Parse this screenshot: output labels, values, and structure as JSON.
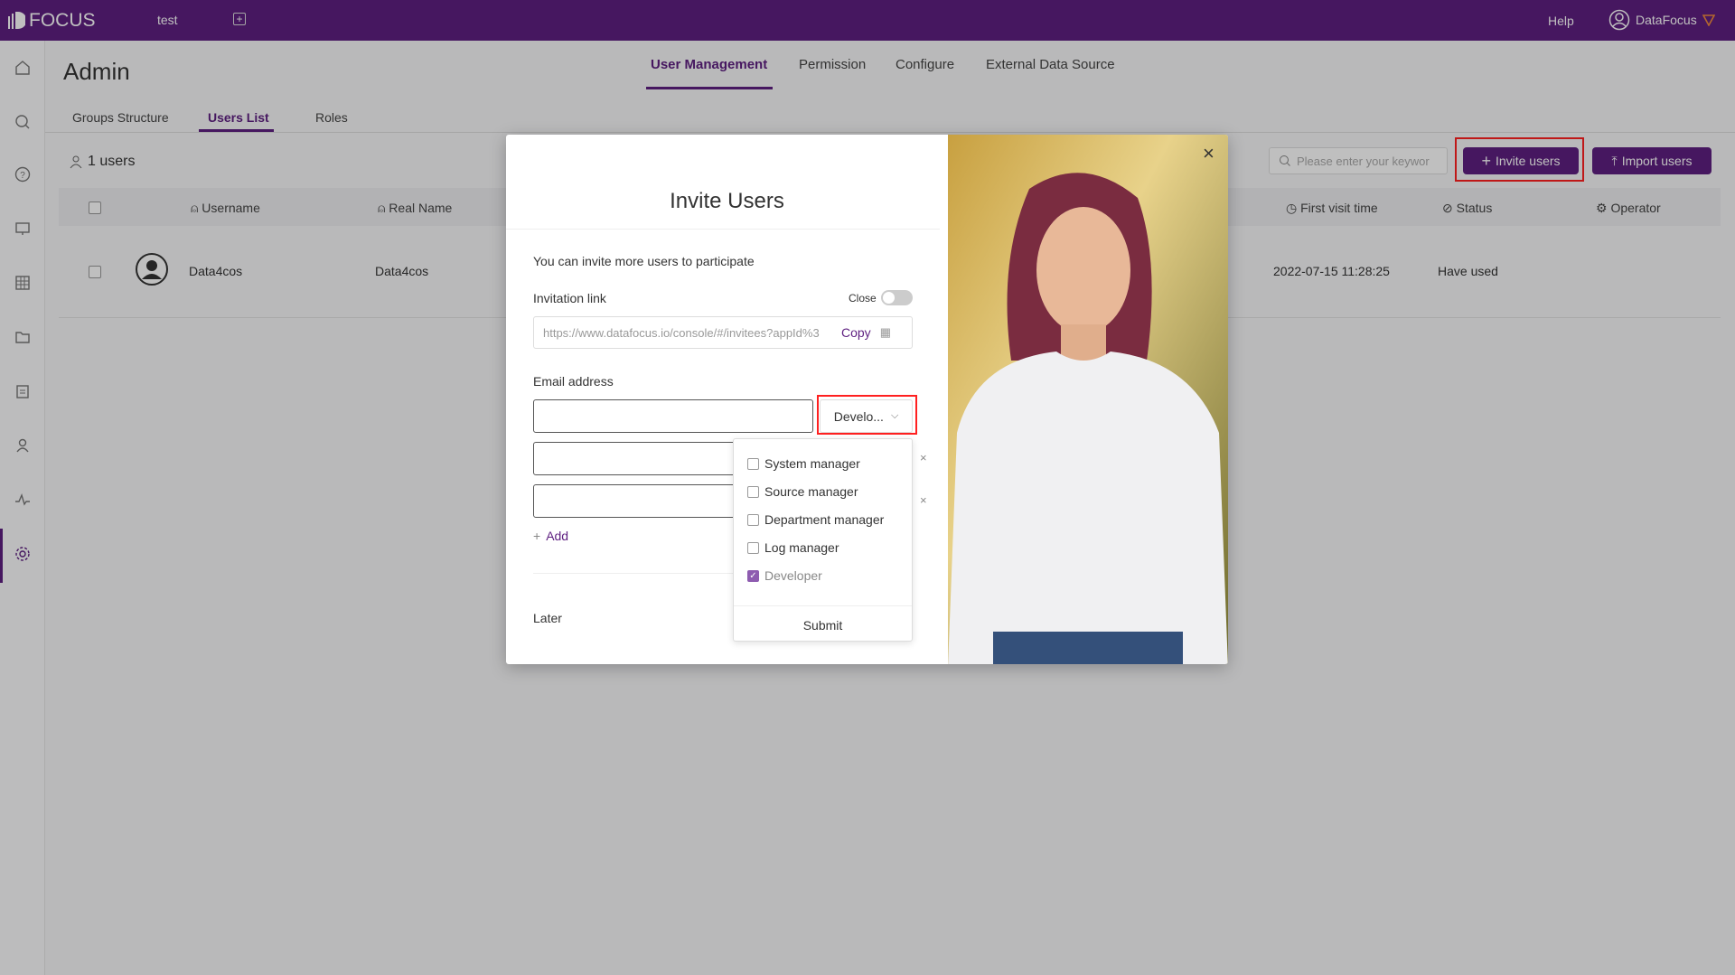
{
  "topbar": {
    "logo": "FOCUS",
    "workspace": "test",
    "help": "Help",
    "user": "DataFocus"
  },
  "sidebar": {
    "icons": [
      "home-icon",
      "search-icon",
      "help-icon",
      "presentation-icon",
      "table-icon",
      "folder-icon",
      "clipboard-icon",
      "user-icon",
      "activity-icon",
      "gear-icon"
    ],
    "active": "gear-icon"
  },
  "page": {
    "title": "Admin",
    "tabs": [
      "User Management",
      "Permission",
      "Configure",
      "External Data Source"
    ],
    "active_tab": "User Management",
    "subtabs": [
      "Groups Structure",
      "Users List",
      "Roles"
    ],
    "active_subtab": "Users List",
    "user_count": "1 users",
    "search_placeholder": "Please enter your keywor",
    "invite_button": "Invite users",
    "import_button": "Import users",
    "columns": [
      "Username",
      "Real Name",
      "First visit time",
      "Status",
      "Operator"
    ],
    "rows": [
      {
        "username": "Data4cos",
        "real_name": "Data4cos",
        "first_visit": "2022-07-15 11:28:25",
        "status": "Have used"
      }
    ]
  },
  "modal": {
    "title": "Invite Users",
    "intro": "You can invite more users to participate",
    "link_label": "Invitation link",
    "toggle_label": "Close",
    "toggle_on": false,
    "link_value": "https://www.datafocus.io/console/#/invitees?appId%3",
    "copy": "Copy",
    "email_label": "Email address",
    "role_selected": "Develo...",
    "add": "Add",
    "later": "Later",
    "role_options": [
      {
        "label": "System manager",
        "checked": false
      },
      {
        "label": "Source manager",
        "checked": false
      },
      {
        "label": "Department manager",
        "checked": false
      },
      {
        "label": "Log manager",
        "checked": false
      },
      {
        "label": "Developer",
        "checked": true
      }
    ],
    "submit": "Submit"
  },
  "colors": {
    "brand": "#5e1f80",
    "highlight": "#ff2020"
  }
}
